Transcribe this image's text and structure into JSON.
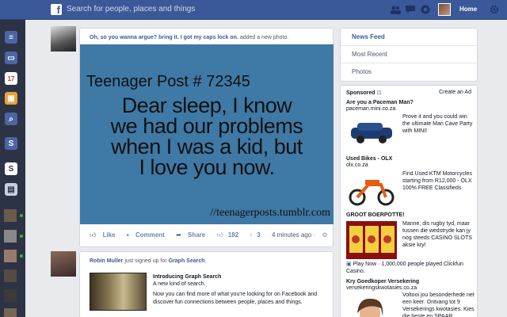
{
  "topbar": {
    "search_placeholder": "Search for people, places and things",
    "home_label": "Home",
    "icons": [
      "friends-icon",
      "messages-icon",
      "notifications-icon",
      "gear-icon"
    ]
  },
  "dock": {
    "apps": [
      "news-feed-icon",
      "messages-icon",
      "calendar-icon",
      "photos-icon",
      "search-icon",
      "app-s-icon",
      "app-s2-icon",
      "notes-icon"
    ],
    "calendar_day": "17"
  },
  "posts": [
    {
      "author": "Oh, so you wanna argue? bring it. I got my caps lock on.",
      "action": "added a new photo.",
      "image": {
        "title": "Teenager Post # 72345",
        "lines": [
          "Dear sleep, I know",
          "we had our problems",
          "when I was a kid, but",
          "I love you now."
        ],
        "credit": "//teenagerposts.tumblr.com"
      },
      "like_label": "Like",
      "comment_label": "Comment",
      "share_label": "Share",
      "likes_count": "182",
      "comments_count": "3",
      "time": "4 minutes ago ·"
    },
    {
      "author": "Robin Muller",
      "action": "just signed up for",
      "target": "Graph Search",
      "target_suffix": ".",
      "link_title": "Introducing Graph Search",
      "link_subtitle": "A new kind of search.",
      "link_desc": "Now you can find more of what you're looking for on Facebook and discover fun connections between people, places and things."
    }
  ],
  "nav": {
    "items": [
      "News Feed",
      "Most Recent",
      "Photos"
    ]
  },
  "ads": {
    "header": "Sponsored",
    "create_label": "Create an Ad",
    "items": [
      {
        "title": "Are you a Paceman Man?",
        "domain": "paceman.mini.co.za",
        "text": "Prove it and you could win the ultimate Man Cave Party with MINI!"
      },
      {
        "title": "Used Bikes - OLX",
        "domain": "olx.co.za",
        "text": "Find Used KTM Motorcycles starting from R12,000 - OLX 100% FREE Classifieds"
      },
      {
        "title": "GROOT BOERPOTTE!",
        "domain": "",
        "text": "Manne, dis rugby tyd, maar tussen die wedstryde kan jy nog steeds CASINO SLOTS aksie kry!",
        "likes": "Play Now · 1,000,000 people played Clickfun Casino."
      },
      {
        "title": "Kry Goedkoper Versekering",
        "domain": "versekeringskwotasies.co.za",
        "text": "Voltooi jou besonderhede net een keer. Ontvang tot 9 Versekerings kwotasies. Kies die beste en SPAAR"
      }
    ]
  },
  "colors": {
    "topbar": "#3b5998",
    "dock": "#2c3345",
    "background": "#e9eaed",
    "meme_bg": "#3f79a5",
    "link": "#3b5998"
  }
}
